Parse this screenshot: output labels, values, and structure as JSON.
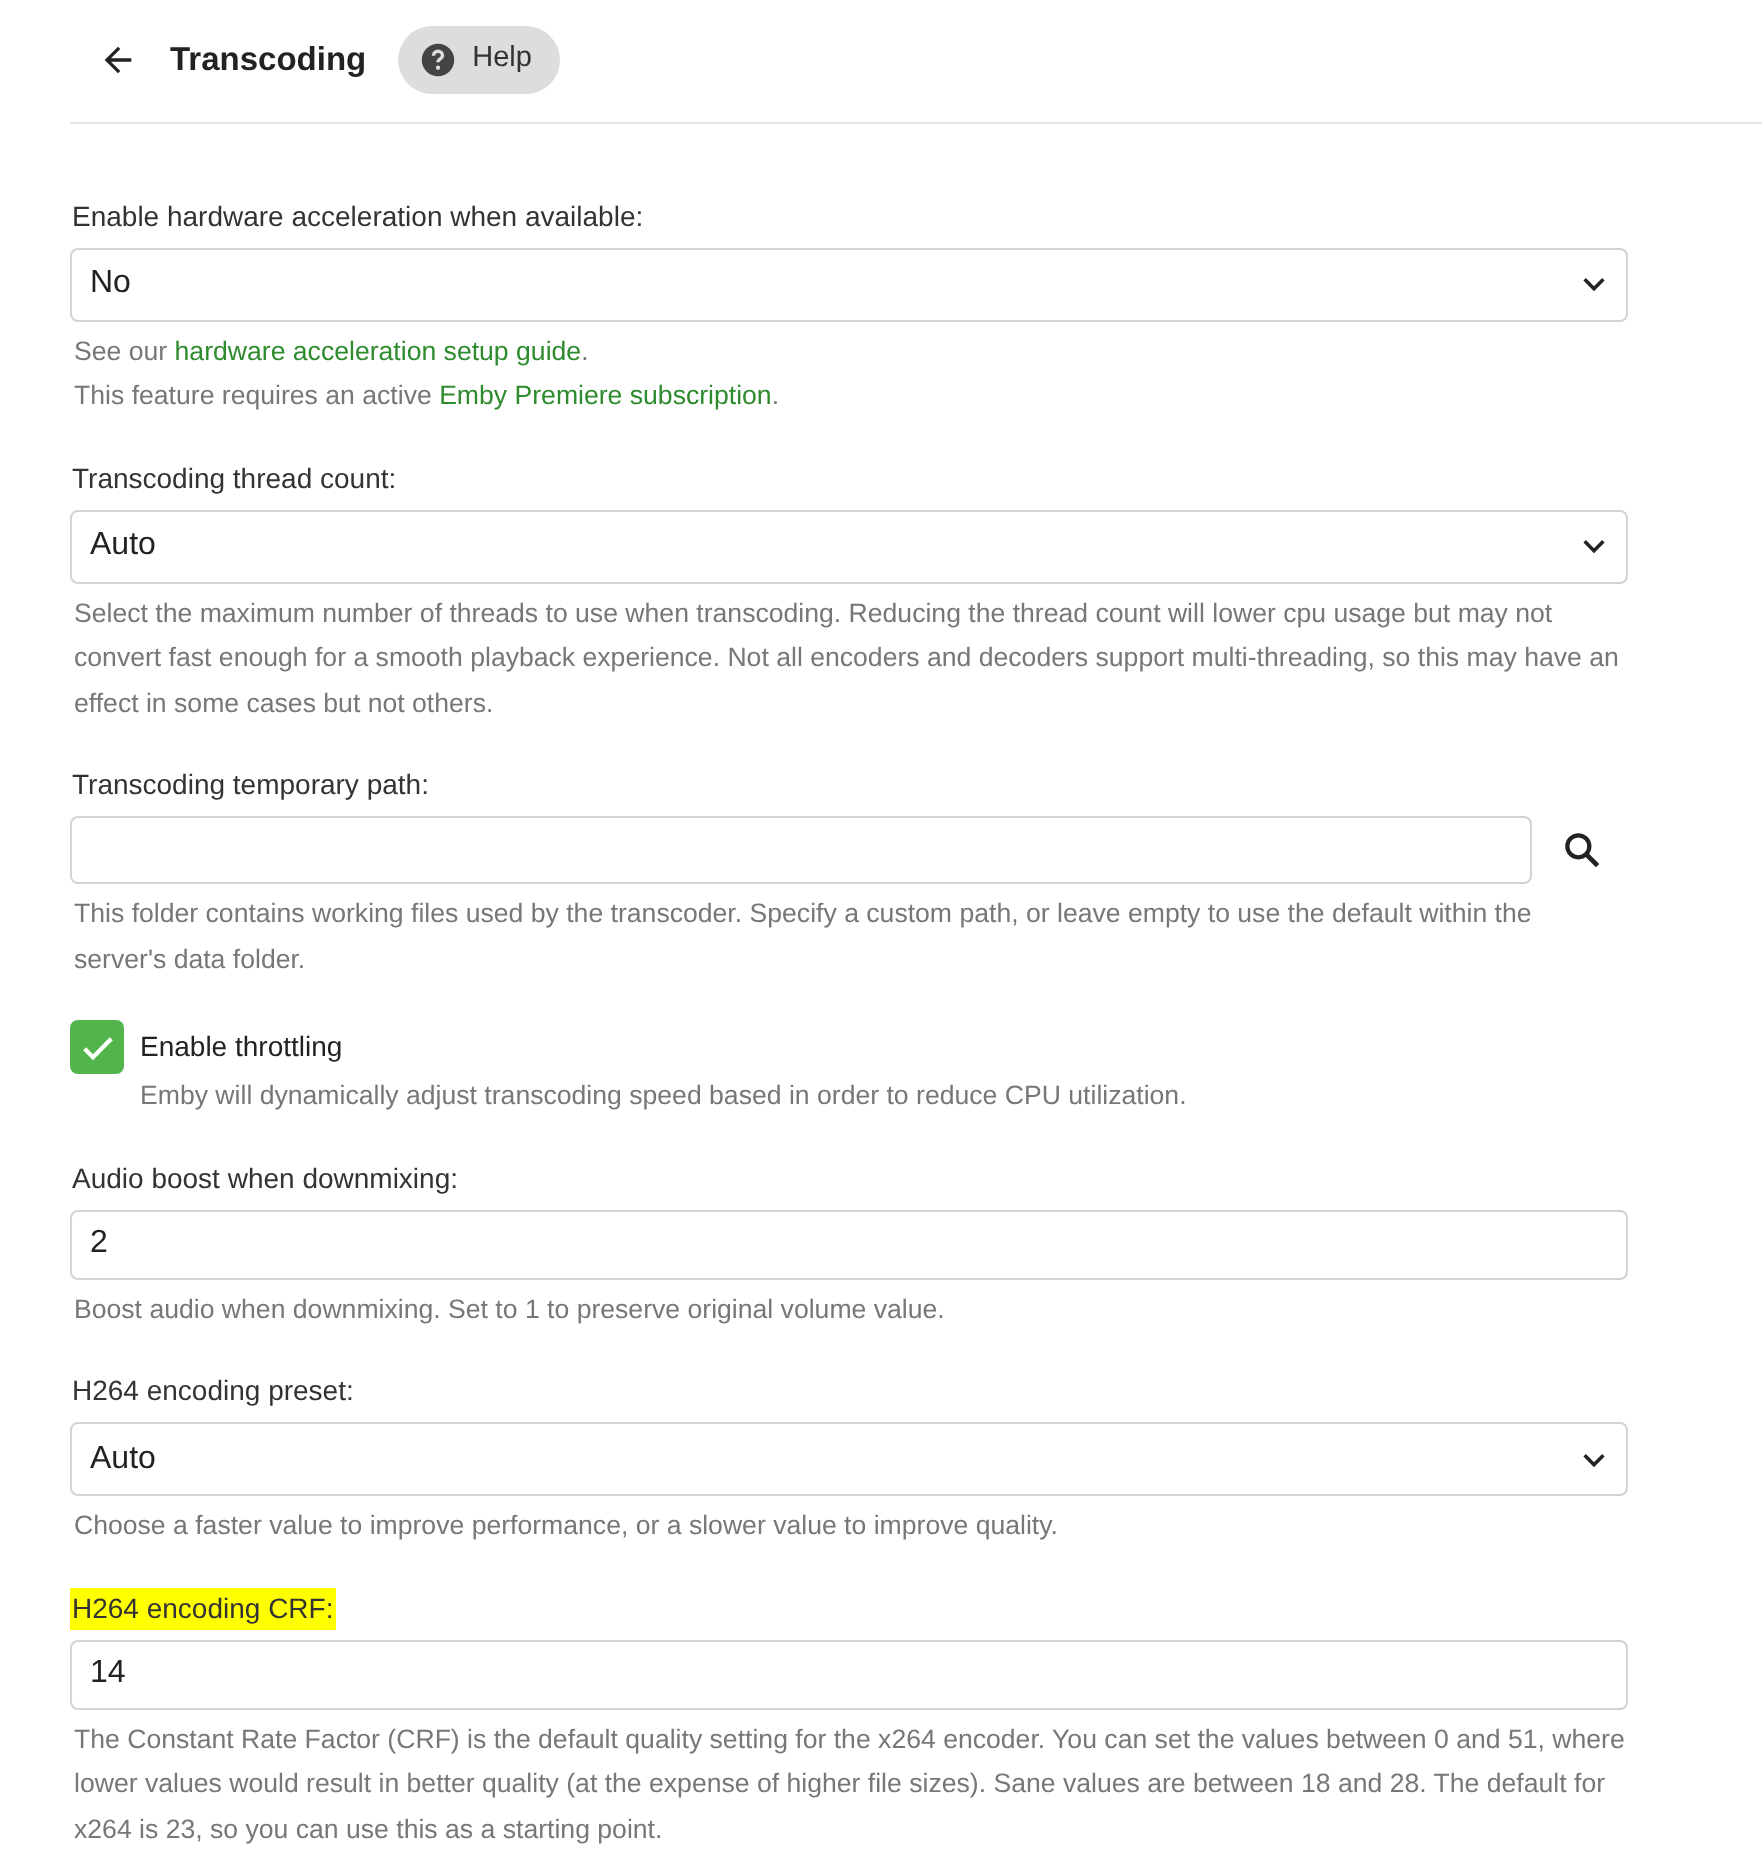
{
  "header": {
    "title": "Transcoding",
    "help_button": "Help"
  },
  "fields": [
    {
      "kind": "select",
      "label": "Enable hardware acceleration when available:",
      "highlighted": false,
      "value": "No",
      "help": [
        [
          {
            "text": "See our "
          },
          {
            "text": "hardware acceleration setup guide",
            "link": true
          },
          {
            "text": "."
          }
        ],
        [
          {
            "text": "This feature requires an active "
          },
          {
            "text": "Emby Premiere subscription",
            "link": true
          },
          {
            "text": "."
          }
        ]
      ]
    },
    {
      "kind": "select",
      "label": "Transcoding thread count:",
      "highlighted": false,
      "value": "Auto",
      "help": [
        [
          {
            "text": "Select the maximum number of threads to use when transcoding. Reducing the thread count will lower cpu usage but may not convert fast enough for a smooth playback experience. Not all encoders and decoders support multi-threading, so this may have an effect in some cases but not others."
          }
        ]
      ]
    },
    {
      "kind": "path",
      "label": "Transcoding temporary path:",
      "highlighted": false,
      "help": [
        [
          {
            "text": "This folder contains working files used by the transcoder. Specify a custom path, or leave empty to use the default within the server's data folder."
          }
        ]
      ]
    },
    {
      "kind": "checkbox",
      "label": "Enable throttling",
      "checked": true,
      "help": [
        [
          {
            "text": "Emby will dynamically adjust transcoding speed based in order to reduce CPU utilization."
          }
        ]
      ]
    },
    {
      "kind": "text",
      "label": "Audio boost when downmixing:",
      "highlighted": false,
      "value": "2",
      "help": [
        [
          {
            "text": "Boost audio when downmixing. Set to 1 to preserve original volume value."
          }
        ]
      ]
    },
    {
      "kind": "select",
      "label": "H264 encoding preset:",
      "highlighted": false,
      "value": "Auto",
      "help": [
        [
          {
            "text": "Choose a faster value to improve performance, or a slower value to improve quality."
          }
        ]
      ]
    },
    {
      "kind": "text",
      "label": "H264 encoding CRF:",
      "highlighted": true,
      "value": "14",
      "help": [
        [
          {
            "text": "The Constant Rate Factor (CRF) is the default quality setting for the x264 encoder. You can set the values between 0 and 51, where lower values would result in better quality (at the expense of higher file sizes). Sane values are between 18 and 28. The default for x264 is 23, so you can use this as a starting point."
          }
        ]
      ]
    }
  ]
}
